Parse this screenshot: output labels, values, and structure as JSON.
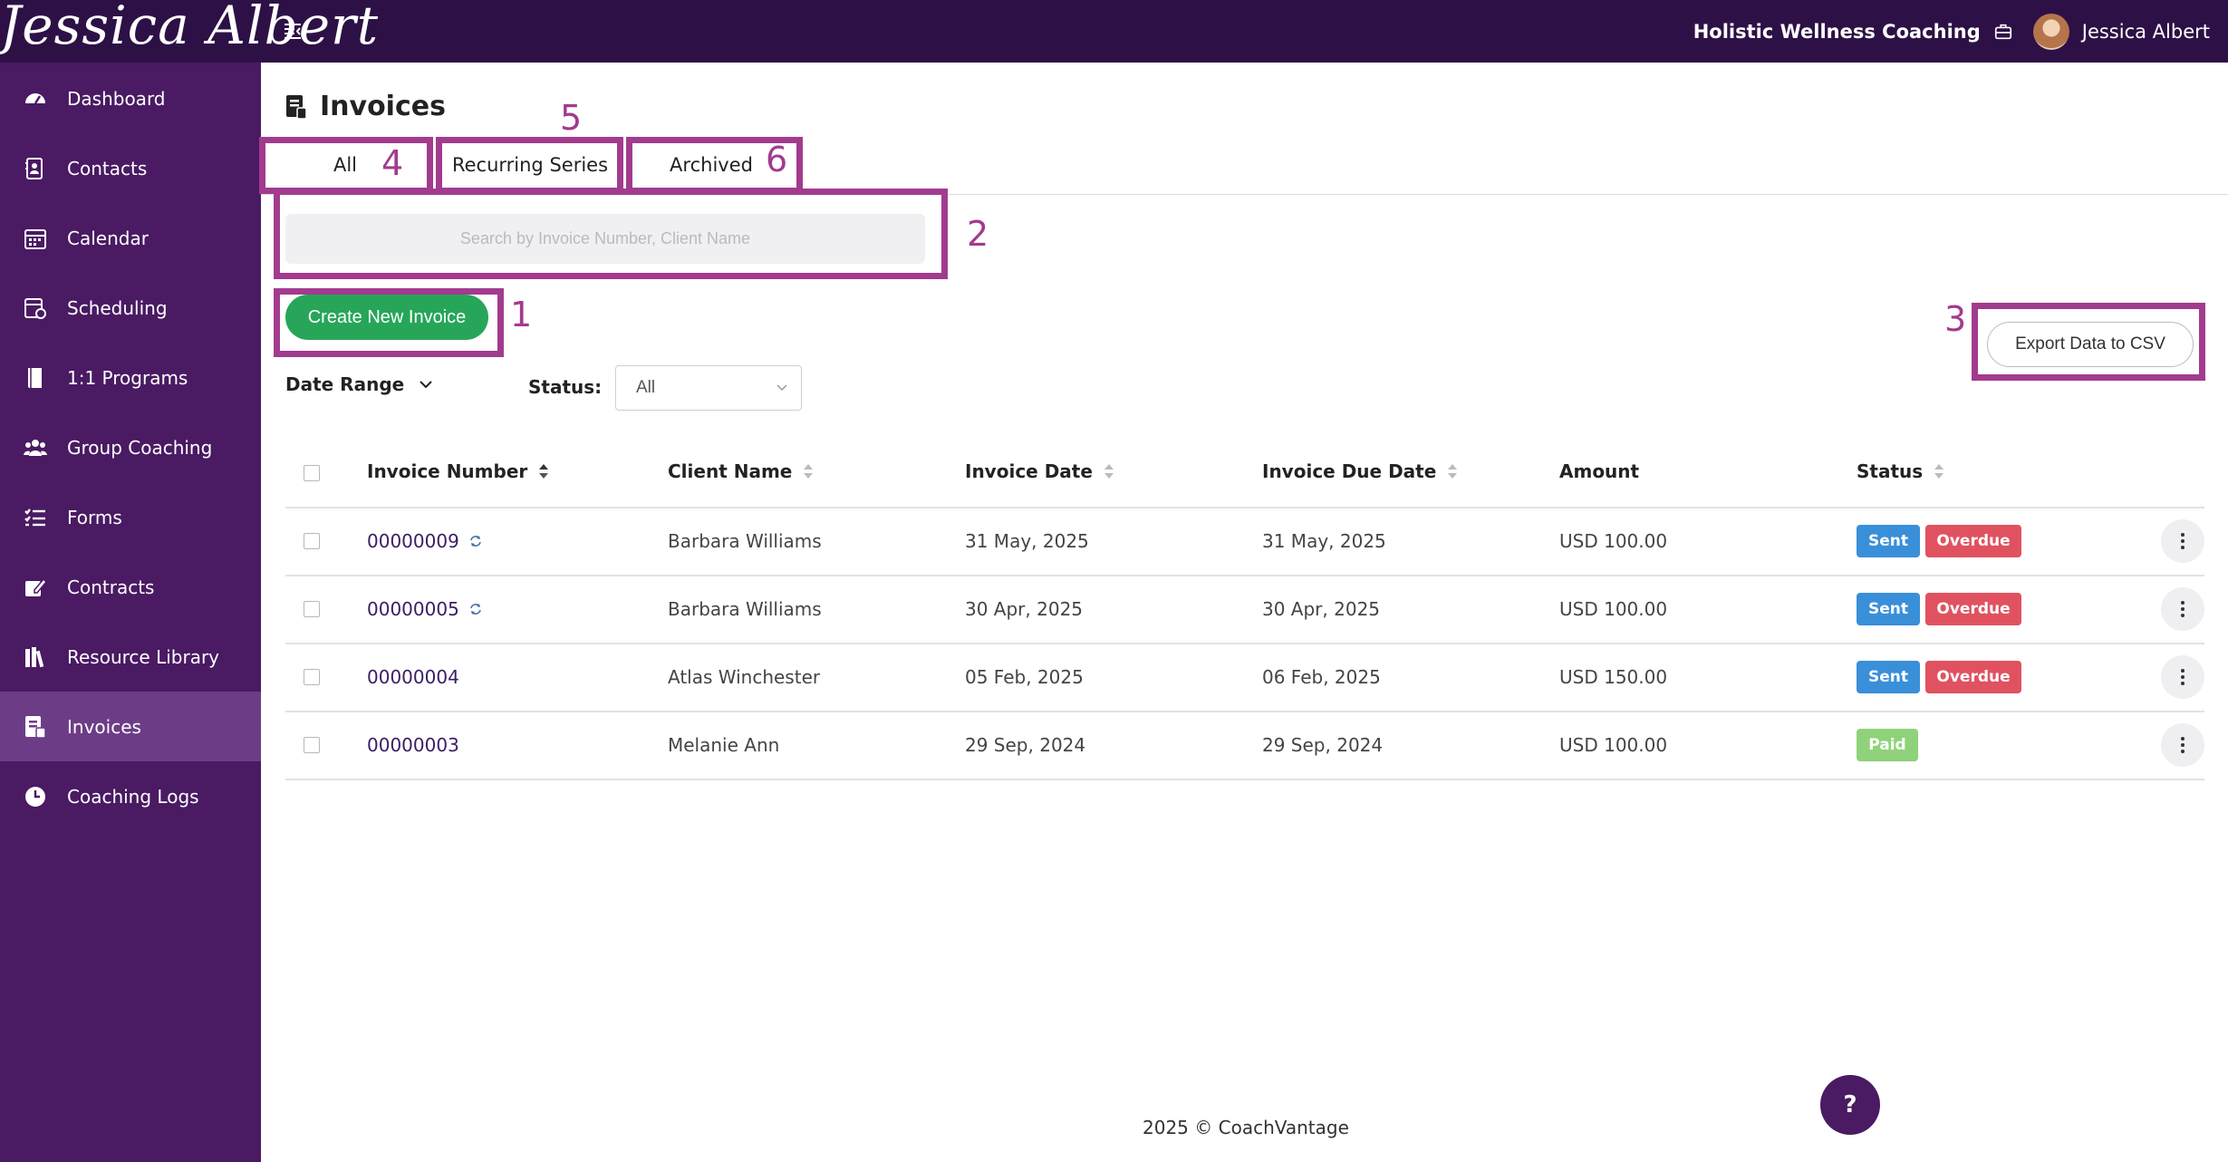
{
  "header": {
    "logo_text": "Jessica Albert",
    "org_name": "Holistic Wellness Coaching",
    "user_name": "Jessica Albert"
  },
  "sidebar": {
    "items": [
      {
        "label": "Dashboard",
        "icon": "dashboard-icon"
      },
      {
        "label": "Contacts",
        "icon": "contacts-icon"
      },
      {
        "label": "Calendar",
        "icon": "calendar-icon"
      },
      {
        "label": "Scheduling",
        "icon": "scheduling-icon"
      },
      {
        "label": "1:1 Programs",
        "icon": "book-icon"
      },
      {
        "label": "Group Coaching",
        "icon": "users-icon"
      },
      {
        "label": "Forms",
        "icon": "forms-icon"
      },
      {
        "label": "Contracts",
        "icon": "signature-icon"
      },
      {
        "label": "Resource Library",
        "icon": "library-icon"
      },
      {
        "label": "Invoices",
        "icon": "invoice-icon",
        "active": true
      },
      {
        "label": "Coaching Logs",
        "icon": "clock-icon"
      }
    ]
  },
  "main": {
    "title": "Invoices",
    "tabs": [
      {
        "label": "All"
      },
      {
        "label": "Recurring Series"
      },
      {
        "label": "Archived"
      }
    ],
    "search": {
      "placeholder": "Search by Invoice Number, Client Name"
    },
    "create_button": "Create New Invoice",
    "export_button": "Export Data to CSV",
    "filters": {
      "date_range_label": "Date Range",
      "status_label": "Status:",
      "status_value": "All"
    },
    "annotations": [
      "1",
      "2",
      "3",
      "4",
      "5",
      "6"
    ],
    "table": {
      "columns": [
        "Invoice Number",
        "Client Name",
        "Invoice Date",
        "Invoice Due Date",
        "Amount",
        "Status"
      ],
      "rows": [
        {
          "number": "00000009",
          "recurring": true,
          "client": "Barbara Williams",
          "date": "31 May, 2025",
          "due": "31 May, 2025",
          "amount": "USD 100.00",
          "statuses": [
            "Sent",
            "Overdue"
          ]
        },
        {
          "number": "00000005",
          "recurring": true,
          "client": "Barbara Williams",
          "date": "30 Apr, 2025",
          "due": "30 Apr, 2025",
          "amount": "USD 100.00",
          "statuses": [
            "Sent",
            "Overdue"
          ]
        },
        {
          "number": "00000004",
          "recurring": false,
          "client": "Atlas Winchester",
          "date": "05 Feb, 2025",
          "due": "06 Feb, 2025",
          "amount": "USD 150.00",
          "statuses": [
            "Sent",
            "Overdue"
          ]
        },
        {
          "number": "00000003",
          "recurring": false,
          "client": "Melanie Ann",
          "date": "29 Sep, 2024",
          "due": "29 Sep, 2024",
          "amount": "USD 100.00",
          "statuses": [
            "Paid"
          ]
        }
      ]
    }
  },
  "footer": {
    "text": "2025 © CoachVantage"
  },
  "help_label": "?",
  "colors": {
    "topbar": "#2d1146",
    "sidebar": "#4a1a63",
    "sidebar_active": "#6c3d86",
    "highlight": "#a23b8e",
    "create_button": "#27a65a",
    "badge_sent": "#3a8fd9",
    "badge_overdue": "#e05260",
    "badge_paid": "#8fd27a"
  }
}
